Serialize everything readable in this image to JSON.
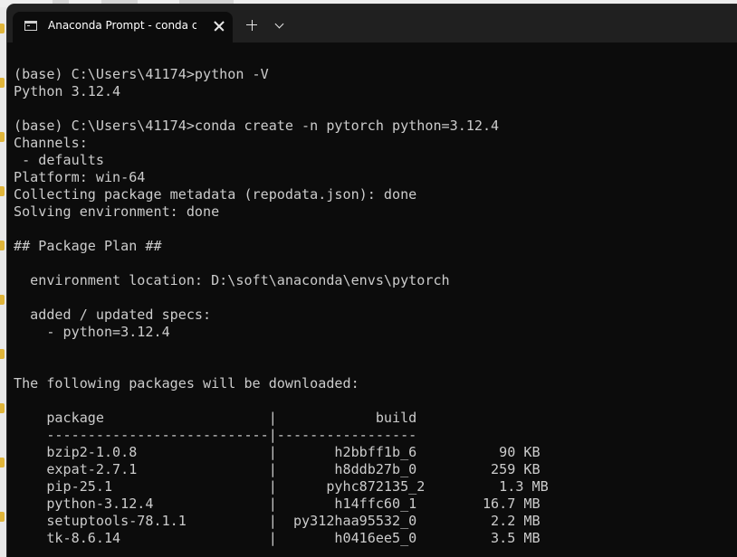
{
  "window": {
    "tab_title": "Anaconda Prompt - conda  cr",
    "icons": {
      "tab_icon": "terminal-icon",
      "close": "close-icon",
      "new_tab": "plus-icon",
      "dropdown": "chevron-down-icon"
    }
  },
  "colors": {
    "terminal_bg": "#0c0c0c",
    "terminal_text": "#cccccc",
    "titlebar_bg": "#202020"
  },
  "terminal": {
    "lines": [
      "(base) C:\\Users\\41174>python -V",
      "Python 3.12.4",
      "",
      "(base) C:\\Users\\41174>conda create -n pytorch python=3.12.4",
      "Channels:",
      " - defaults",
      "Platform: win-64",
      "Collecting package metadata (repodata.json): done",
      "Solving environment: done",
      "",
      "## Package Plan ##",
      "",
      "  environment location: D:\\soft\\anaconda\\envs\\pytorch",
      "",
      "  added / updated specs:",
      "    - python=3.12.4",
      "",
      "",
      "The following packages will be downloaded:",
      "",
      "    package                    |            build",
      "    ---------------------------|-----------------",
      "    bzip2-1.0.8                |       h2bbff1b_6          90 KB",
      "    expat-2.7.1                |       h8ddb27b_0         259 KB",
      "    pip-25.1                   |      pyhc872135_2         1.3 MB",
      "    python-3.12.4              |       h14ffc60_1        16.7 MB",
      "    setuptools-78.1.1          |  py312haa95532_0         2.2 MB",
      "    tk-8.6.14                  |       h0416ee5_0         3.5 MB"
    ]
  }
}
